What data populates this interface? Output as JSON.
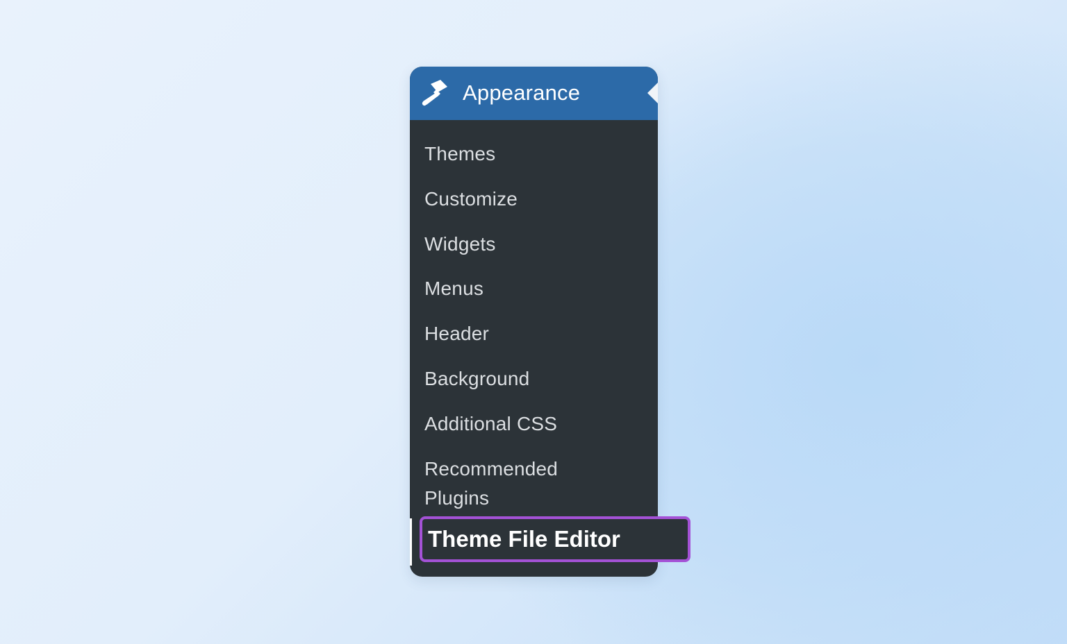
{
  "menu": {
    "header": {
      "icon": "paintbrush-icon",
      "title": "Appearance",
      "color": "#2c6aa8"
    },
    "items": [
      {
        "label": "Themes"
      },
      {
        "label": "Customize"
      },
      {
        "label": "Widgets"
      },
      {
        "label": "Menus"
      },
      {
        "label": "Header"
      },
      {
        "label": "Background"
      },
      {
        "label": "Additional CSS"
      },
      {
        "label": "Recommended Plugins"
      }
    ],
    "current_item": {
      "label": "Theme File Editor",
      "highlight_color": "#a452d6"
    },
    "background_color": "#2c3338"
  }
}
